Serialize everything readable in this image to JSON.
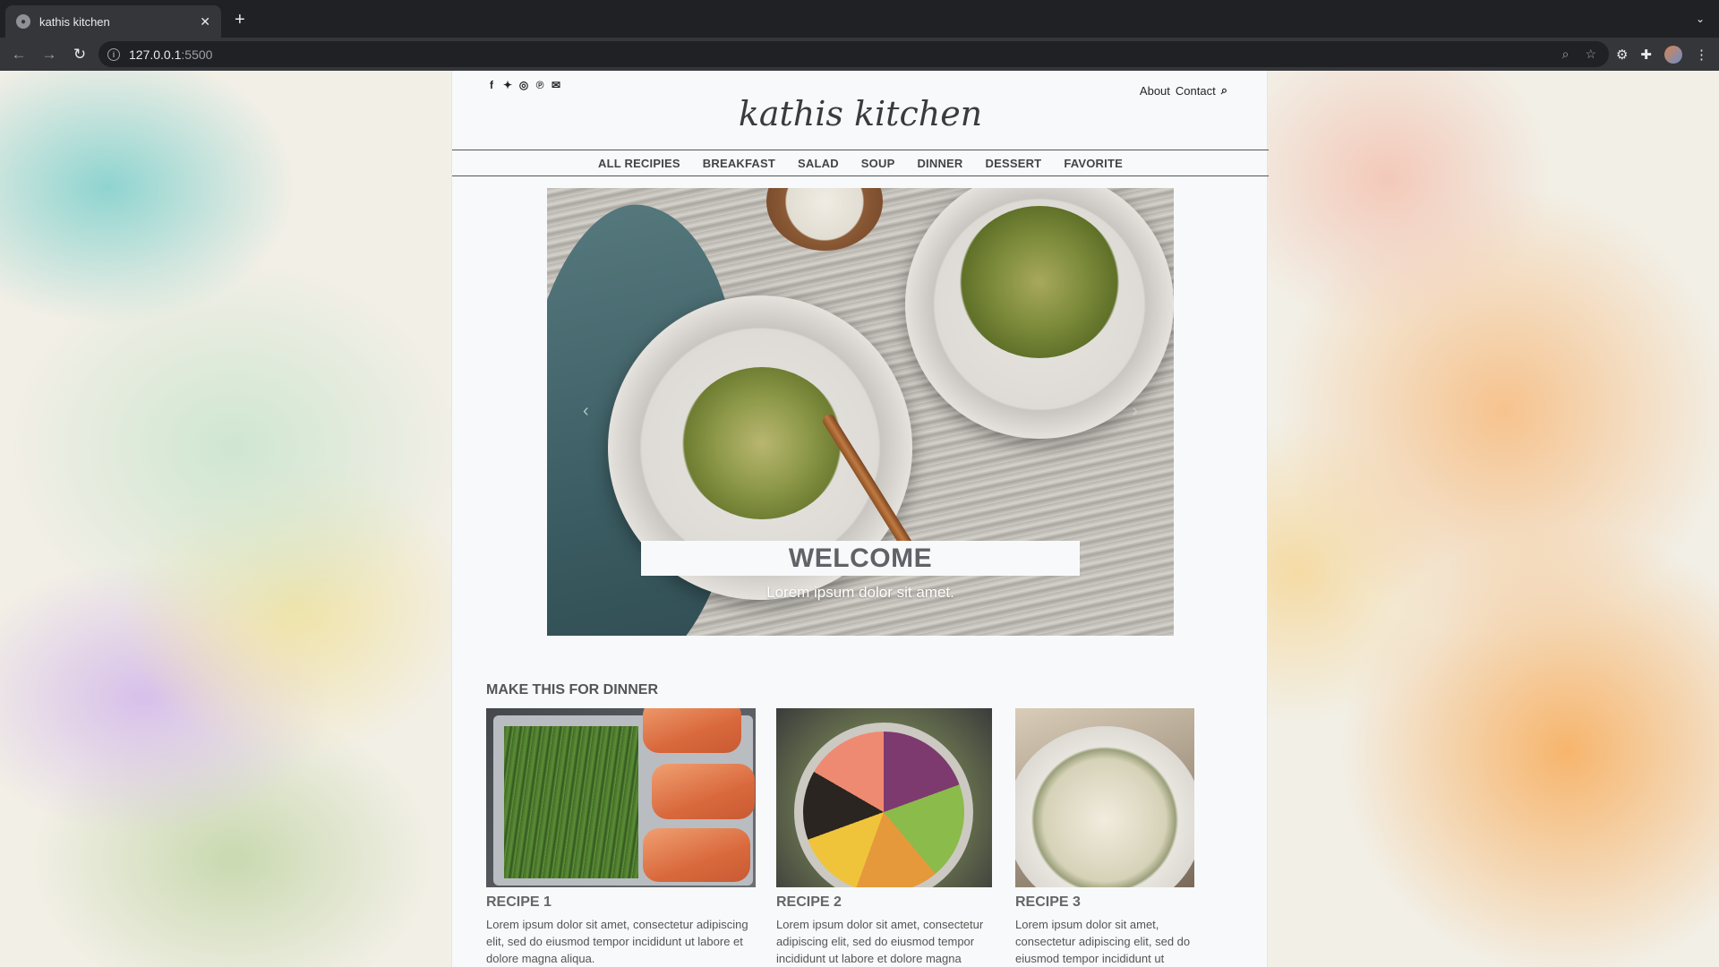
{
  "browser": {
    "tab_title": "kathis kitchen",
    "url_host": "127.0.0.1",
    "url_port": ":5500",
    "icons": [
      "back-icon",
      "forward-icon",
      "reload-icon",
      "info-icon",
      "zoom-icon",
      "star-icon",
      "extension-icon",
      "puzzle-icon",
      "profile-avatar",
      "menu-icon"
    ]
  },
  "site": {
    "logo": "kathis kitchen",
    "social_icons": [
      "facebook-icon",
      "twitter-icon",
      "instagram-icon",
      "pinterest-icon",
      "email-icon"
    ],
    "top_links": {
      "about": "About",
      "contact": "Contact"
    },
    "nav": [
      "ALL RECIPIES",
      "BREAKFAST",
      "SALAD",
      "SOUP",
      "DINNER",
      "DESSERT",
      "FAVORITE"
    ]
  },
  "carousel": {
    "title": "WELCOME",
    "subtitle": "Lorem ipsum dolor sit amet."
  },
  "section": {
    "title": "MAKE THIS FOR DINNER",
    "cards": [
      {
        "title": "RECIPE 1",
        "text": "Lorem ipsum dolor sit amet, consectetur adipiscing elit, sed do eiusmod tempor incididunt ut labore et dolore magna aliqua."
      },
      {
        "title": "RECIPE 2",
        "text": "Lorem ipsum dolor sit amet, consectetur adipiscing elit, sed do eiusmod tempor incididunt ut labore et dolore magna"
      },
      {
        "title": "RECIPE 3",
        "text": "Lorem ipsum dolor sit amet, consectetur adipiscing elit, sed do eiusmod tempor incididunt ut labore et dolore magna"
      }
    ]
  },
  "colors": {
    "page_bg": "#f8f9fa",
    "nav_text": "#444444",
    "chrome_bg": "#202124"
  }
}
